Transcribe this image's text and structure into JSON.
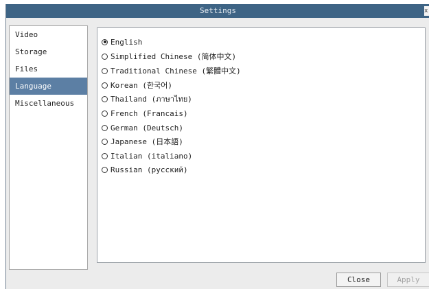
{
  "window": {
    "title": "Settings",
    "close_glyph": "x"
  },
  "sidebar": {
    "items": [
      {
        "label": "Video"
      },
      {
        "label": "Storage"
      },
      {
        "label": "Files"
      },
      {
        "label": "Language",
        "selected": true
      },
      {
        "label": "Miscellaneous"
      }
    ]
  },
  "language": {
    "selected": "English",
    "options": [
      {
        "label": "English",
        "checked": true
      },
      {
        "label": "Simplified Chinese (简体中文)"
      },
      {
        "label": "Traditional Chinese (繁體中文)"
      },
      {
        "label": "Korean (한국어)"
      },
      {
        "label": "Thailand (ภาษาไทย)"
      },
      {
        "label": "French (Francais)"
      },
      {
        "label": "German (Deutsch)"
      },
      {
        "label": "Japanese (日本語)"
      },
      {
        "label": "Italian (italiano)"
      },
      {
        "label": "Russian (русский)"
      }
    ]
  },
  "buttons": {
    "close": "Close",
    "apply": "Apply",
    "apply_enabled": false
  },
  "colors": {
    "titlebar": "#3e6485",
    "selection": "#5c7fa4"
  }
}
